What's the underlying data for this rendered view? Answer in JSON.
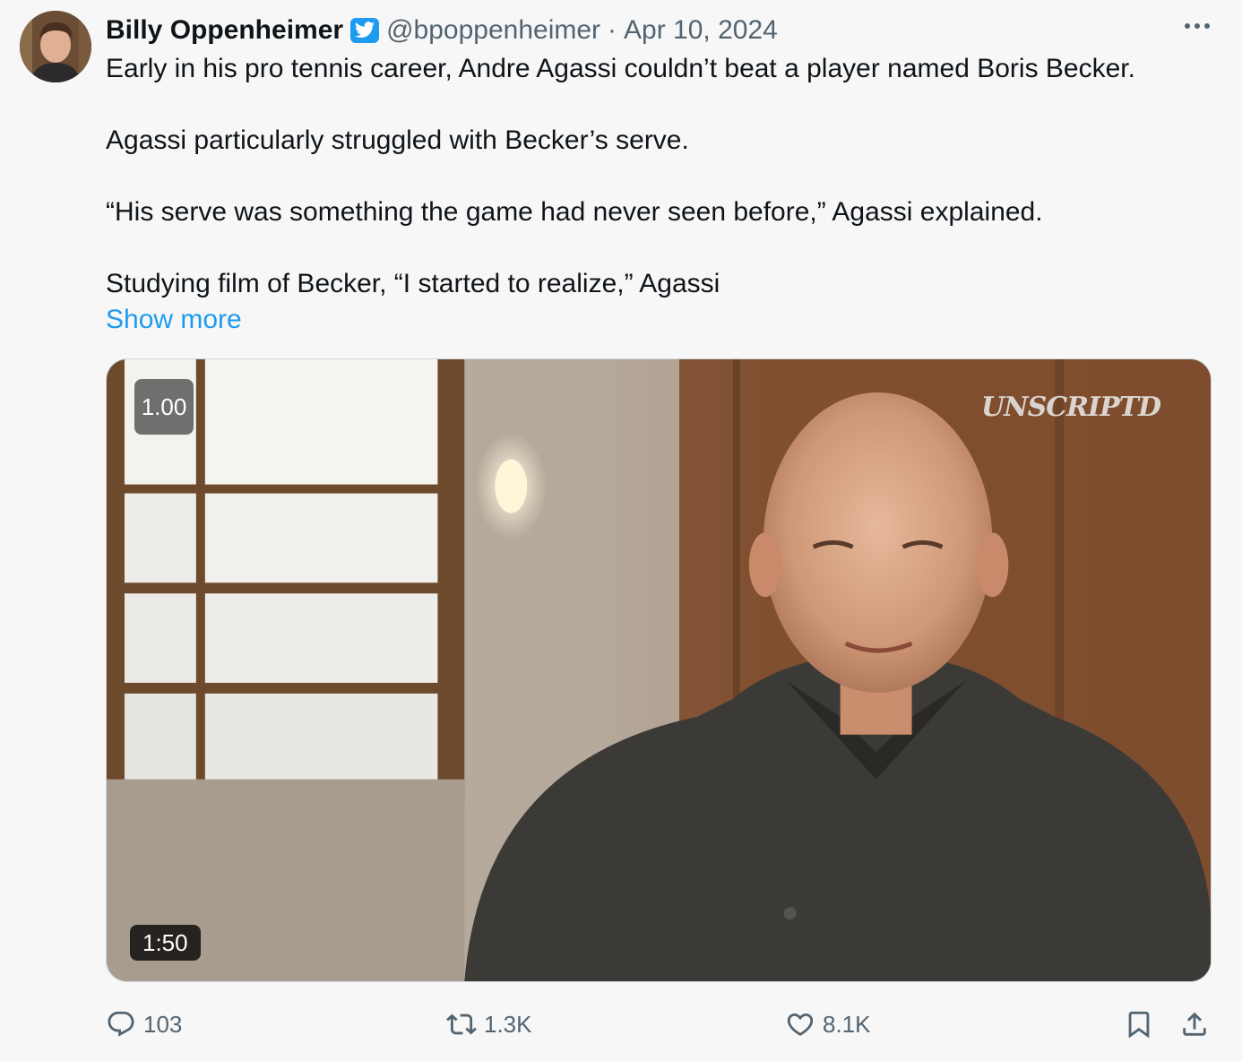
{
  "author": {
    "name": "Billy Oppenheimer",
    "handle": "@bpoppenheimer",
    "separator": "·",
    "date": "Apr 10, 2024",
    "verified_icon": "twitter-bird-badge-icon"
  },
  "tweet": {
    "paragraphs": [
      "Early in his pro tennis career, Andre Agassi couldn’t beat a player named Boris Becker.",
      "Agassi particularly struggled with Becker’s serve.",
      "“His serve was something the game had never seen before,” Agassi explained.",
      "Studying film of Becker, “I started to realize,” Agassi"
    ],
    "show_more_label": "Show more"
  },
  "media": {
    "speed_label": "1.00",
    "watermark": "UNSCRIPTD",
    "duration": "1:50"
  },
  "actions": {
    "reply_count": "103",
    "retweet_count": "1.3K",
    "like_count": "8.1K"
  },
  "colors": {
    "background": "#f7f7f7",
    "accent": "#1d9bf0",
    "secondary_text": "#536471",
    "primary_text": "#0f1419"
  }
}
